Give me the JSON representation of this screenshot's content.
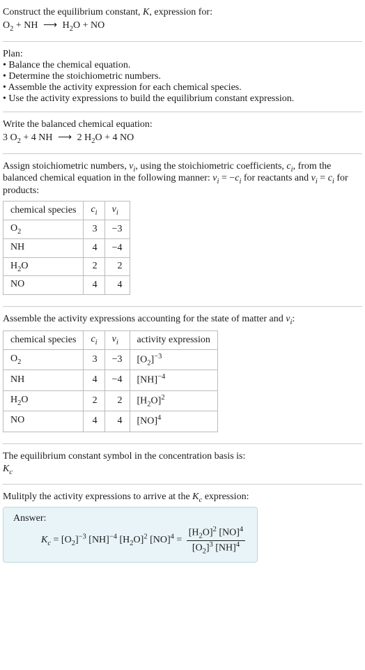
{
  "intro": {
    "line1_a": "Construct the equilibrium constant, ",
    "line1_K": "K",
    "line1_b": ", expression for:",
    "eq_lhs1": "O",
    "eq_lhs1_sub": "2",
    "eq_plus": " + NH ",
    "eq_arrow": "⟶",
    "eq_rhs": " H",
    "eq_rhs_sub": "2",
    "eq_rhs2": "O + NO"
  },
  "plan": {
    "title": "Plan:",
    "b1": "• Balance the chemical equation.",
    "b2": "• Determine the stoichiometric numbers.",
    "b3": "• Assemble the activity expression for each chemical species.",
    "b4": "• Use the activity expressions to build the equilibrium constant expression."
  },
  "balanced": {
    "title": "Write the balanced chemical equation:",
    "lhs": "3 O",
    "lhs_sub": "2",
    "mid": " + 4 NH ",
    "arrow": "⟶",
    "rhs_a": " 2 H",
    "rhs_sub": "2",
    "rhs_b": "O + 4 NO"
  },
  "assign": {
    "p1": "Assign stoichiometric numbers, ",
    "nu": "ν",
    "sub_i": "i",
    "p2": ", using the stoichiometric coefficients, ",
    "c": "c",
    "p3": ", from the balanced chemical equation in the following manner: ",
    "eq1_l": "ν",
    "eq1_eq": " = −",
    "eq1_r": "c",
    "p4": " for reactants and ",
    "eq2_l": "ν",
    "eq2_eq": " = ",
    "eq2_r": "c",
    "p5": " for products:"
  },
  "table1": {
    "h1": "chemical species",
    "h2": "c",
    "h2_sub": "i",
    "h3": "ν",
    "h3_sub": "i",
    "r1": {
      "sp_a": "O",
      "sp_sub": "2",
      "sp_b": "",
      "c": "3",
      "nu": "−3"
    },
    "r2": {
      "sp_a": "NH",
      "sp_sub": "",
      "sp_b": "",
      "c": "4",
      "nu": "−4"
    },
    "r3": {
      "sp_a": "H",
      "sp_sub": "2",
      "sp_b": "O",
      "c": "2",
      "nu": "2"
    },
    "r4": {
      "sp_a": "NO",
      "sp_sub": "",
      "sp_b": "",
      "c": "4",
      "nu": "4"
    }
  },
  "assemble": {
    "p1": "Assemble the activity expressions accounting for the state of matter and ",
    "nu": "ν",
    "sub_i": "i",
    "p2": ":"
  },
  "table2": {
    "h1": "chemical species",
    "h2": "c",
    "h2_sub": "i",
    "h3": "ν",
    "h3_sub": "i",
    "h4": "activity expression",
    "r1": {
      "sp_a": "O",
      "sp_sub": "2",
      "sp_b": "",
      "c": "3",
      "nu": "−3",
      "act_a": "[O",
      "act_sub": "2",
      "act_b": "]",
      "act_sup": "−3"
    },
    "r2": {
      "sp_a": "NH",
      "sp_sub": "",
      "sp_b": "",
      "c": "4",
      "nu": "−4",
      "act_a": "[NH]",
      "act_sub": "",
      "act_b": "",
      "act_sup": "−4"
    },
    "r3": {
      "sp_a": "H",
      "sp_sub": "2",
      "sp_b": "O",
      "c": "2",
      "nu": "2",
      "act_a": "[H",
      "act_sub": "2",
      "act_b": "O]",
      "act_sup": "2"
    },
    "r4": {
      "sp_a": "NO",
      "sp_sub": "",
      "sp_b": "",
      "c": "4",
      "nu": "4",
      "act_a": "[NO]",
      "act_sub": "",
      "act_b": "",
      "act_sup": "4"
    }
  },
  "basis": {
    "p1": "The equilibrium constant symbol in the concentration basis is:",
    "K": "K",
    "sub": "c"
  },
  "final": {
    "p1": "Mulitply the activity expressions to arrive at the ",
    "K": "K",
    "sub": "c",
    "p2": " expression:"
  },
  "answer": {
    "label": "Answer:",
    "K": "K",
    "K_sub": "c",
    "eq": " = [O",
    "t1_sub": "2",
    "t1_b": "]",
    "t1_sup": "−3",
    "t2": " [NH]",
    "t2_sup": "−4",
    "t3": " [H",
    "t3_sub": "2",
    "t3_b": "O]",
    "t3_sup": "2",
    "t4": " [NO]",
    "t4_sup": "4",
    "eq2": " = ",
    "num_a": "[H",
    "num_a_sub": "2",
    "num_a_b": "O]",
    "num_a_sup": "2",
    "num_b": " [NO]",
    "num_b_sup": "4",
    "den_a": "[O",
    "den_a_sub": "2",
    "den_a_b": "]",
    "den_a_sup": "3",
    "den_b": " [NH]",
    "den_b_sup": "4"
  }
}
